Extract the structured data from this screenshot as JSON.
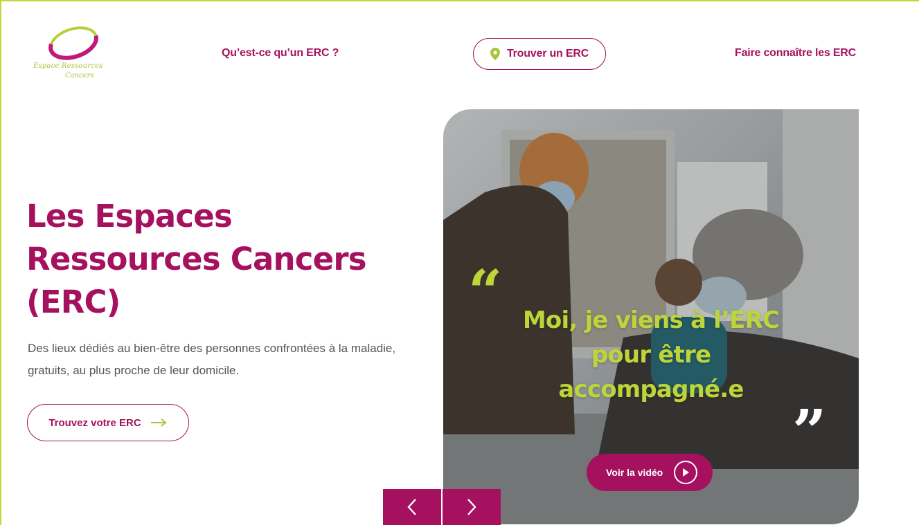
{
  "brand": {
    "logo_line1": "Espace Ressources",
    "logo_line2": "Cancers",
    "primary_color": "#a5115e",
    "accent_color": "#bed53a"
  },
  "nav": {
    "what_label": "Qu’est-ce qu’un ERC ?",
    "find_label": "Trouver un ERC",
    "find_icon": "location-pin-icon",
    "promote_label": "Faire connaître les ERC"
  },
  "hero": {
    "title_line1": "Les Espaces",
    "title_line2": "Ressources Cancers",
    "title_line3": "(ERC)",
    "description": "Des lieux dédiés au bien-être des personnes confrontées à la maladie, gratuits, au plus proche de leur domicile.",
    "cta_label": "Trouvez votre ERC",
    "cta_icon": "arrow-right-icon"
  },
  "media": {
    "quote_line1": "Moi, je viens à l’ERC",
    "quote_line2": "pour être",
    "quote_line3": "accompagné.e",
    "video_label": "Voir la vidéo",
    "video_icon": "play-icon",
    "prev_icon": "chevron-left-icon",
    "next_icon": "chevron-right-icon"
  }
}
